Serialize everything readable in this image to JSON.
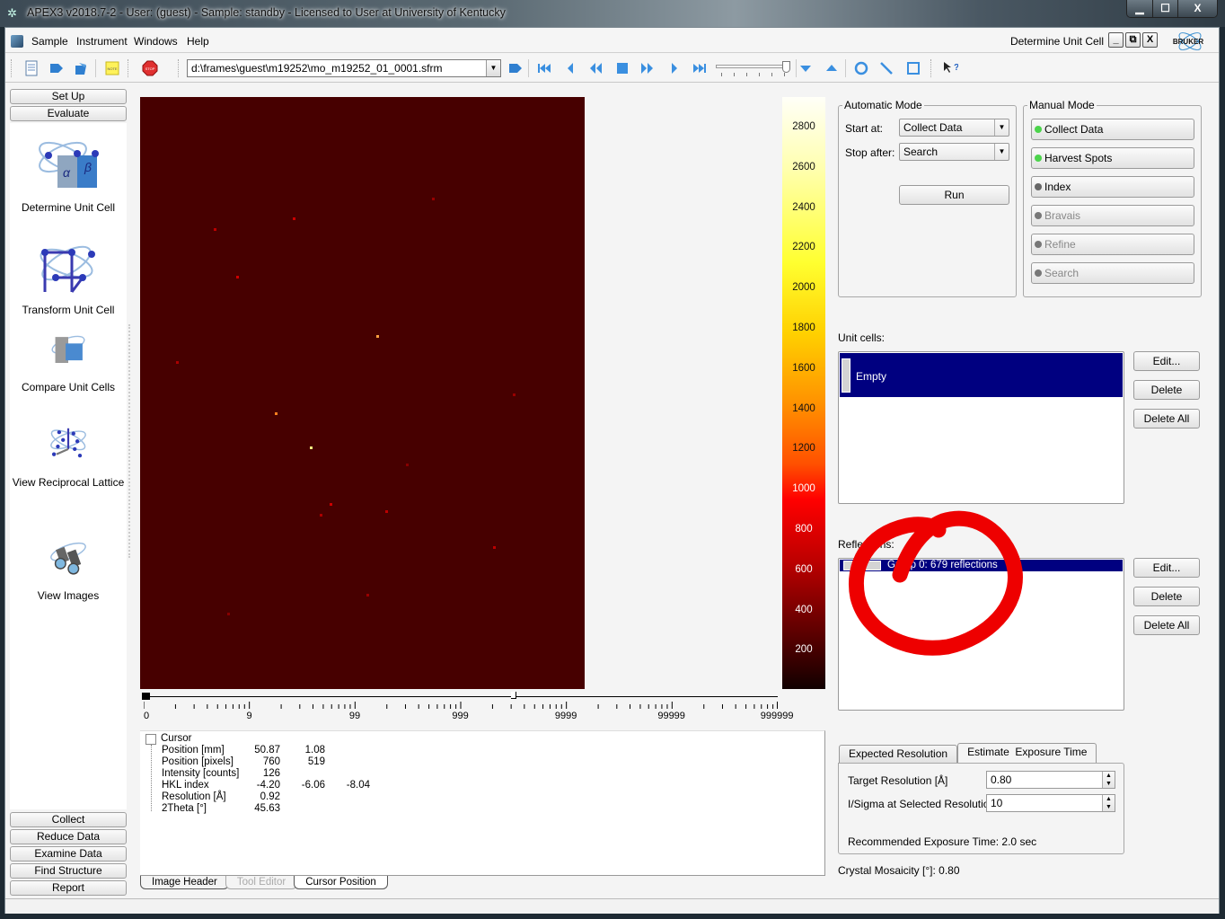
{
  "window": {
    "title": "APEX3 v2018.7-2 - User: (guest) - Sample: standby - Licensed to User at University of Kentucky",
    "controls": [
      "minimize",
      "maximize",
      "close"
    ],
    "close_glyph": "X"
  },
  "menubar": {
    "items": [
      "Sample",
      "Instrument",
      "Windows",
      "Help"
    ],
    "mdi_title": "Determine Unit Cell",
    "mdi_controls": [
      "_",
      "⧉",
      "X"
    ],
    "brand": "BRUKER"
  },
  "toolbar": {
    "frame_path": "d:\\frames\\guest\\m19252\\mo_m19252_01_0001.sfrm",
    "icons": [
      "new-document-icon",
      "open-icon",
      "open-folder-icon",
      "note-icon",
      "stop-icon",
      "open-frame-icon",
      "first-frame-icon",
      "previous-frame-icon",
      "fast-rewind-icon",
      "stop-playback-icon",
      "fast-forward-icon",
      "next-frame-icon",
      "last-frame-icon",
      "zoom-in-icon",
      "zoom-out-icon",
      "circle-tool-icon",
      "line-tool-icon",
      "rectangle-tool-icon",
      "context-help-icon"
    ],
    "zoom_slider_fraction": 0.95
  },
  "sidebar": {
    "top_buttons": [
      "Set Up",
      "Evaluate"
    ],
    "tools": [
      {
        "label": "Determine Unit Cell",
        "icon": "determine-unit-cell-icon"
      },
      {
        "label": "Transform Unit Cell",
        "icon": "transform-unit-cell-icon"
      },
      {
        "label": "Compare Unit Cells",
        "icon": "compare-unit-cells-icon"
      },
      {
        "label": "View Reciprocal Lattice",
        "icon": "reciprocal-lattice-icon"
      },
      {
        "label": "View Images",
        "icon": "binoculars-icon"
      }
    ],
    "bottom_buttons": [
      "Collect",
      "Reduce Data",
      "Examine Data",
      "Find Structure",
      "Report"
    ]
  },
  "viewer": {
    "colorbar_labels": [
      "2800",
      "2600",
      "2400",
      "2200",
      "2000",
      "1800",
      "1600",
      "1400",
      "1200",
      "1000",
      "800",
      "600",
      "400",
      "200"
    ],
    "contrast_scale_labels": [
      "0",
      "9",
      "99",
      "999",
      "9999",
      "99999",
      "999999"
    ],
    "contrast_min_fraction": 0.0,
    "contrast_max_fraction": 0.58
  },
  "cursor_info": {
    "header": "Cursor",
    "rows": [
      {
        "label": "Position [mm]",
        "values": [
          "50.87",
          "1.08"
        ]
      },
      {
        "label": "Position [pixels]",
        "values": [
          "760",
          "519"
        ]
      },
      {
        "label": "Intensity [counts]",
        "values": [
          "126"
        ]
      },
      {
        "label": "HKL index",
        "values": [
          "-4.20",
          "-6.06",
          "-8.04"
        ]
      },
      {
        "label": "Resolution [Å]",
        "values": [
          "0.92"
        ]
      },
      {
        "label": "2Theta [°]",
        "values": [
          "45.63"
        ]
      }
    ],
    "tabs": [
      {
        "label": "Image Header",
        "state": "normal"
      },
      {
        "label": "Tool Editor",
        "state": "disabled"
      },
      {
        "label": "Cursor Position",
        "state": "active"
      }
    ]
  },
  "automatic_mode": {
    "title": "Automatic Mode",
    "start_at_label": "Start at:",
    "start_at_value": "Collect Data",
    "stop_after_label": "Stop after:",
    "stop_after_value": "Search",
    "run_label": "Run"
  },
  "manual_mode": {
    "title": "Manual Mode",
    "steps": [
      {
        "label": "Collect Data",
        "status": "done",
        "color": "#4cd44c"
      },
      {
        "label": "Harvest Spots",
        "status": "done",
        "color": "#4cd44c"
      },
      {
        "label": "Index",
        "status": "pending",
        "color": "#666666"
      },
      {
        "label": "Bravais",
        "status": "disabled",
        "color": "#777777"
      },
      {
        "label": "Refine",
        "status": "disabled",
        "color": "#777777"
      },
      {
        "label": "Search",
        "status": "disabled",
        "color": "#777777"
      }
    ]
  },
  "unit_cells": {
    "label": "Unit cells:",
    "items": [
      "Empty"
    ],
    "buttons": [
      "Edit...",
      "Delete",
      "Delete All"
    ]
  },
  "reflections": {
    "label": "Reflections:",
    "items": [
      "Group 0: 679 reflections"
    ],
    "buttons": [
      "Edit...",
      "Delete",
      "Delete All"
    ]
  },
  "exposure": {
    "tabs": [
      "Expected Resolution",
      "Estimate  Exposure Time"
    ],
    "active_tab": 1,
    "target_resolution_label": "Target Resolution [Å]",
    "target_resolution_value": "0.80",
    "isigma_label": "I/Sigma at Selected Resolution",
    "isigma_value": "10",
    "recommended_label": "Recommended Exposure Time:",
    "recommended_value": "2.0 sec",
    "mosaicity_label": "Crystal Mosaicity [°]:",
    "mosaicity_value": "0.80"
  },
  "colors": {
    "selection": "#000080",
    "frame_background": "#470000",
    "annotation": "#ee0000"
  }
}
